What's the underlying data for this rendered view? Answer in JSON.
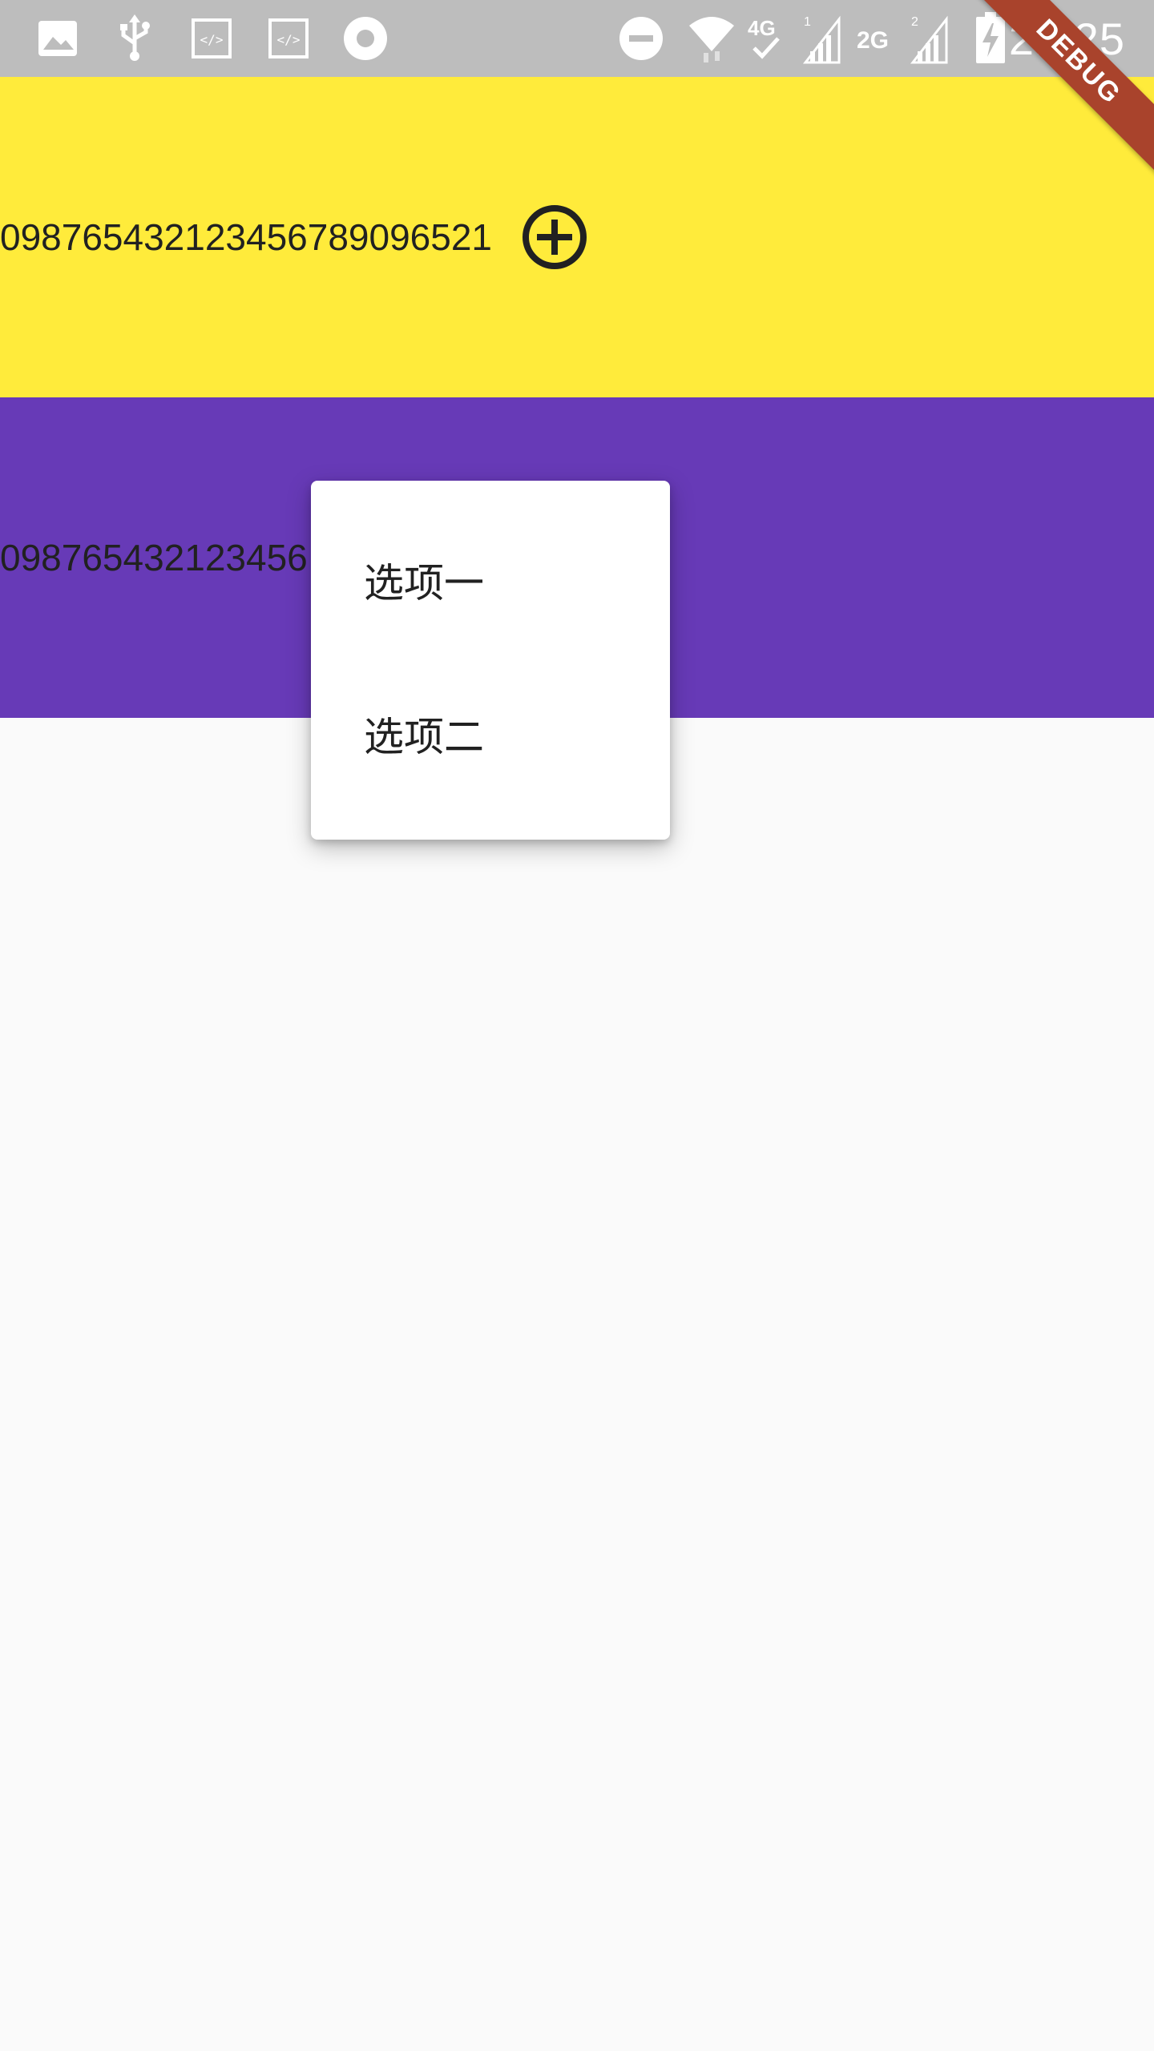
{
  "status_bar": {
    "time": "21:25",
    "background": "#bdbdbd",
    "left_icons": [
      "image-icon",
      "usb-icon",
      "code-icon",
      "code-icon",
      "record-icon"
    ],
    "right_icons": [
      "do-not-disturb-icon",
      "wifi-icon",
      "4g-icon",
      "signal-icon",
      "2g-icon",
      "signal-icon",
      "battery-charging-icon"
    ]
  },
  "debug_banner": {
    "label": "DEBUG",
    "color": "#a9432c"
  },
  "rows": [
    {
      "text": "098765432123456789096521",
      "background": "#ffeb3b",
      "icon": "add-circle-icon"
    },
    {
      "text": "098765432123456",
      "background": "#673ab7"
    }
  ],
  "popup_menu": {
    "items": [
      {
        "label": "选项一"
      },
      {
        "label": "选项二"
      }
    ]
  },
  "colors": {
    "page_background": "#fafafa",
    "text": "#212121"
  }
}
